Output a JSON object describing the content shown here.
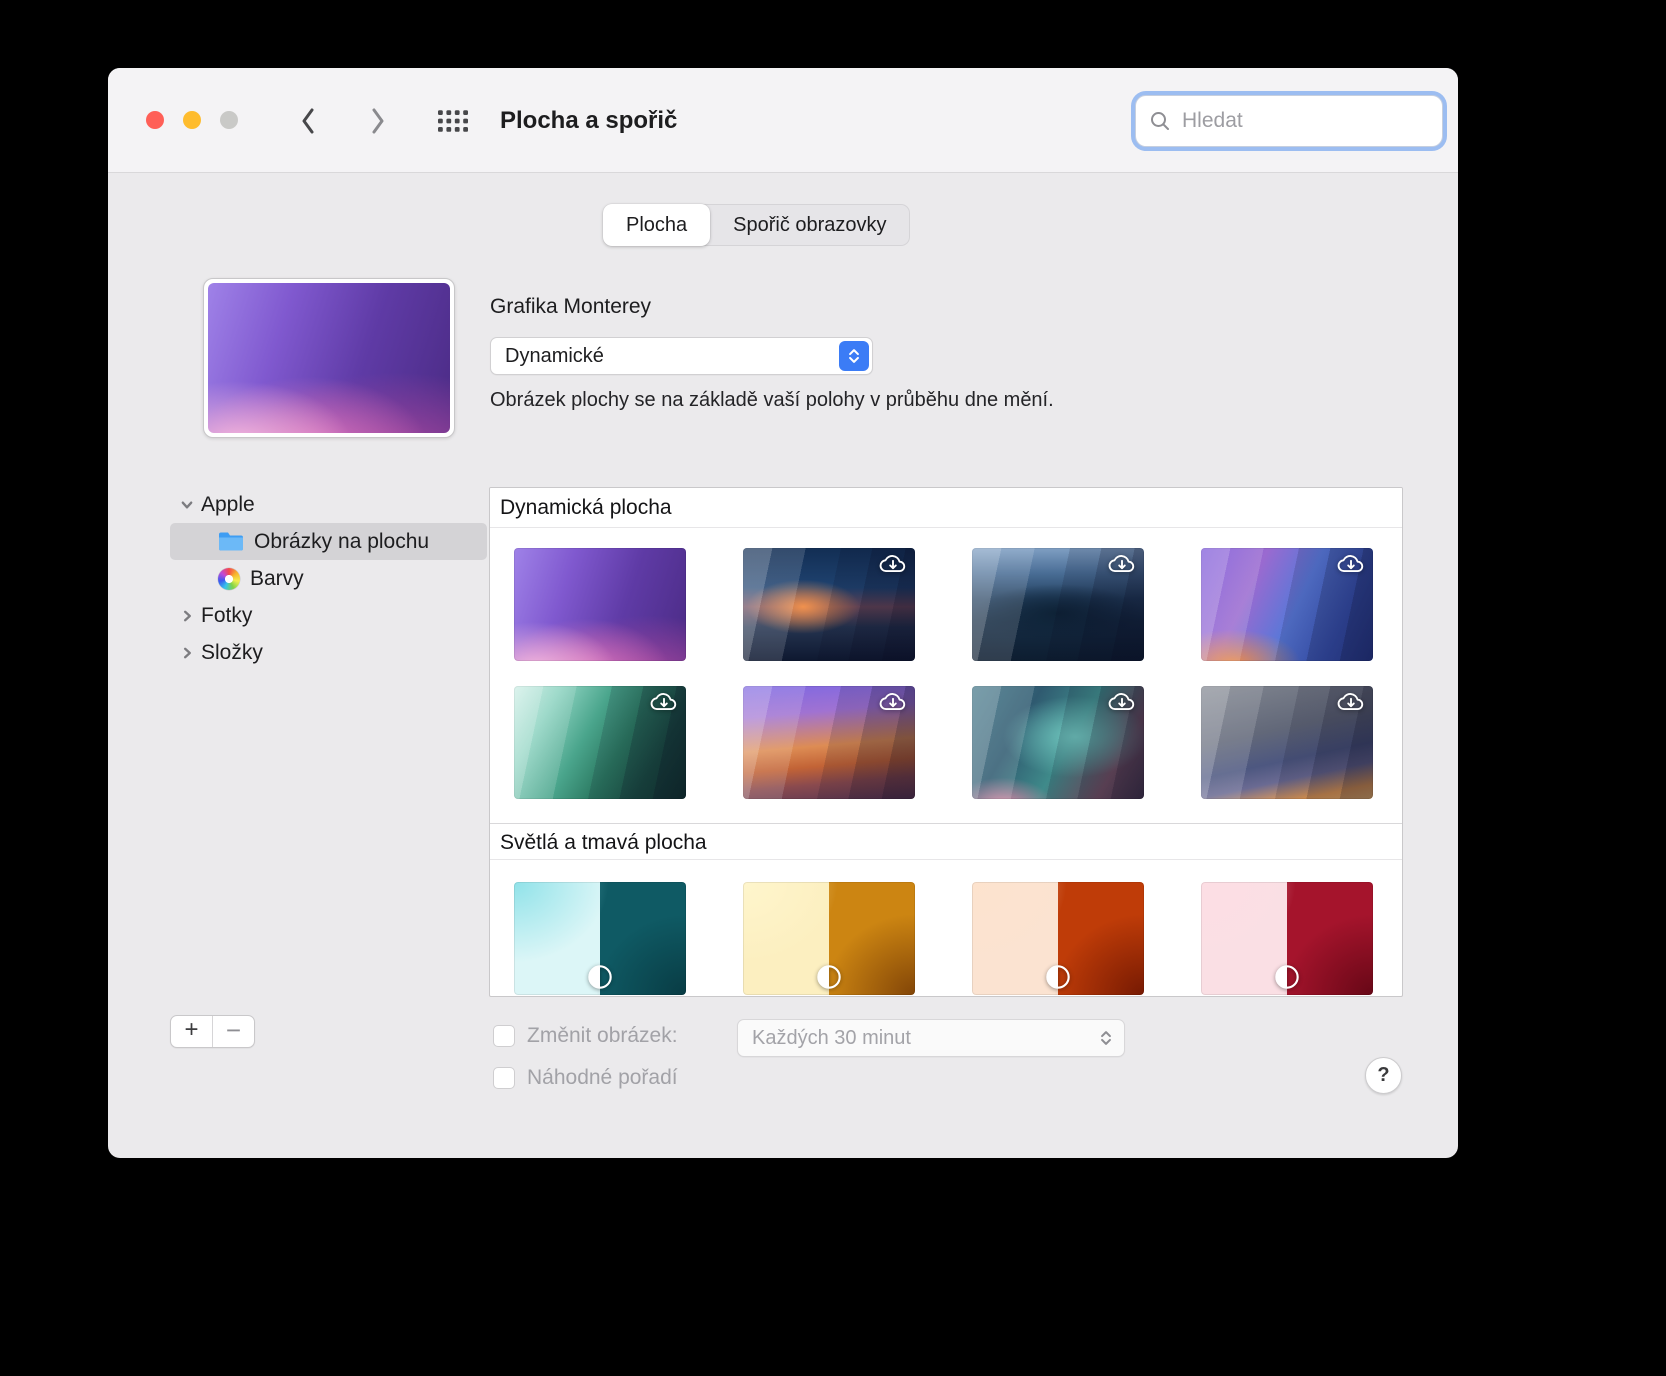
{
  "window": {
    "title": "Plocha a spořič",
    "search_placeholder": "Hledat"
  },
  "tabs": [
    {
      "label": "Plocha",
      "selected": true
    },
    {
      "label": "Spořič obrazovky",
      "selected": false
    }
  ],
  "preview": {
    "name": "Grafika Monterey",
    "mode_value": "Dynamické",
    "description": "Obrázek plochy se na základě vaší polohy v průběhu dne mění."
  },
  "sidebar": {
    "items": [
      {
        "label": "Apple",
        "type": "group",
        "expanded": true
      },
      {
        "label": "Obrázky na plochu",
        "icon": "folder-icon",
        "selected": true
      },
      {
        "label": "Barvy",
        "icon": "colors-wheel-icon",
        "selected": false
      },
      {
        "label": "Fotky",
        "type": "group",
        "expanded": false
      },
      {
        "label": "Složky",
        "type": "group",
        "expanded": false
      }
    ]
  },
  "main": {
    "sections": [
      {
        "title": "Dynamická plocha",
        "thumbs": [
          {
            "name": "monterey",
            "style": "monterey",
            "dynamic": false,
            "download": false,
            "lightdark": false
          },
          {
            "name": "big-sur-coast",
            "style": "bigsur",
            "dynamic": true,
            "download": true,
            "lightdark": false
          },
          {
            "name": "catalina",
            "style": "catalina",
            "dynamic": true,
            "download": true,
            "lightdark": false
          },
          {
            "name": "big-sur-road",
            "style": "road",
            "dynamic": true,
            "download": true,
            "lightdark": false
          },
          {
            "name": "canyon",
            "style": "canyon",
            "dynamic": true,
            "download": true,
            "lightdark": false
          },
          {
            "name": "desert",
            "style": "desert",
            "dynamic": true,
            "download": true,
            "lightdark": false
          },
          {
            "name": "beach",
            "style": "beach",
            "dynamic": true,
            "download": true,
            "lightdark": false
          },
          {
            "name": "solstice",
            "style": "solstice",
            "dynamic": true,
            "download": true,
            "lightdark": false
          }
        ]
      },
      {
        "title": "Světlá a tmavá plocha",
        "thumbs": [
          {
            "name": "abstract-cyan",
            "style": "cyan",
            "dynamic": false,
            "download": false,
            "lightdark": true
          },
          {
            "name": "abstract-yellow",
            "style": "yellow",
            "dynamic": false,
            "download": false,
            "lightdark": true
          },
          {
            "name": "abstract-orange",
            "style": "orange",
            "dynamic": false,
            "download": false,
            "lightdark": true
          },
          {
            "name": "abstract-red",
            "style": "red",
            "dynamic": false,
            "download": false,
            "lightdark": true
          }
        ]
      }
    ]
  },
  "footer": {
    "add_label": "+",
    "remove_label": "−",
    "change_picture_label": "Změnit obrázek:",
    "interval_value": "Každých 30 minut",
    "random_order_label": "Náhodné pořadí",
    "help_label": "?"
  },
  "colors": {
    "accent_blue": "#3b7cf6",
    "focus_ring": "#9cbdf1",
    "traffic_red": "#ff5f57",
    "traffic_yellow": "#febc2e",
    "traffic_gray": "#c9c9c7",
    "selected_row": "#d4d3d6"
  },
  "icons": [
    "search-icon",
    "back-icon",
    "forward-icon",
    "show-all-grid-icon",
    "stepper-icon",
    "folder-icon",
    "colors-wheel-icon",
    "chevron-down-icon",
    "chevron-right-icon",
    "cloud-download-icon",
    "light-dark-icon",
    "help-icon"
  ]
}
